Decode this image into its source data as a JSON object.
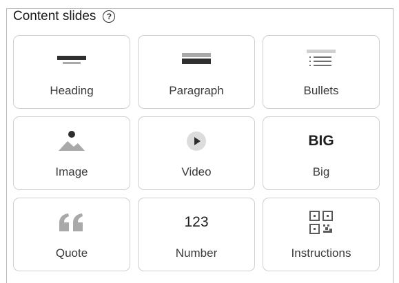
{
  "panel": {
    "title": "Content slides",
    "help_glyph": "?"
  },
  "tiles": [
    {
      "label": "Heading",
      "icon": "heading-icon"
    },
    {
      "label": "Paragraph",
      "icon": "paragraph-icon"
    },
    {
      "label": "Bullets",
      "icon": "bullets-icon"
    },
    {
      "label": "Image",
      "icon": "image-icon"
    },
    {
      "label": "Video",
      "icon": "play-icon"
    },
    {
      "label": "Big",
      "icon": "big-text-icon",
      "icon_text": "BIG"
    },
    {
      "label": "Quote",
      "icon": "quote-icon"
    },
    {
      "label": "Number",
      "icon": "number-icon",
      "icon_text": "123"
    },
    {
      "label": "Instructions",
      "icon": "qr-code-icon"
    }
  ]
}
